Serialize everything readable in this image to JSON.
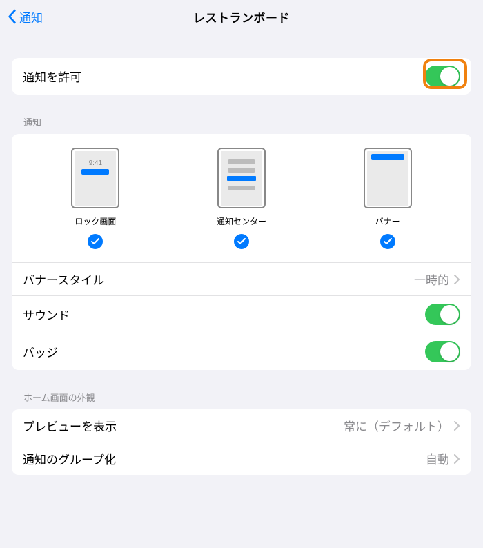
{
  "header": {
    "back": "通知",
    "title": "レストランボード"
  },
  "allow": {
    "label": "通知を許可",
    "on": true
  },
  "sections": {
    "notif_header": "通知",
    "home_header": "ホーム画面の外観"
  },
  "styles": {
    "lock_time": "9:41",
    "lock": "ロック画面",
    "center": "通知センター",
    "banner": "バナー"
  },
  "rows": {
    "banner_style": {
      "label": "バナースタイル",
      "detail": "一時的"
    },
    "sound": {
      "label": "サウンド",
      "on": true
    },
    "badge": {
      "label": "バッジ",
      "on": true
    },
    "preview": {
      "label": "プレビューを表示",
      "detail": "常に（デフォルト）"
    },
    "grouping": {
      "label": "通知のグループ化",
      "detail": "自動"
    }
  }
}
